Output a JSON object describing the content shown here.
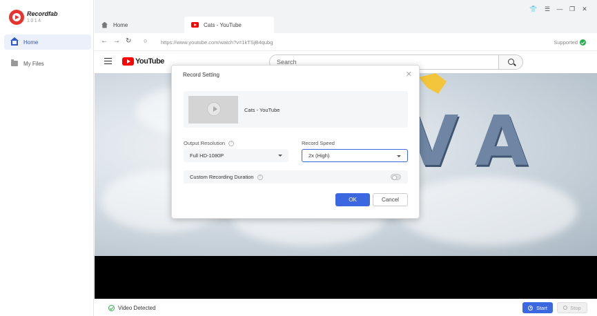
{
  "app": {
    "name": "Recordfab",
    "version": "1014"
  },
  "sidebar": {
    "items": [
      {
        "label": "Home",
        "active": true
      },
      {
        "label": "My Files",
        "active": false
      }
    ]
  },
  "tabs": [
    {
      "label": "Home",
      "icon": "home-icon"
    },
    {
      "label": "Cats - YouTube",
      "icon": "youtube-icon",
      "active": true
    }
  ],
  "window_controls": [
    "shirt-icon",
    "menu-icon",
    "minimize-icon",
    "restore-icon",
    "close-icon"
  ],
  "addressbar": {
    "url": "https://www.youtube.com/watch?v=1kTSjB4qubg",
    "supported": "Supported"
  },
  "youtube": {
    "logo_text": "YouTube",
    "search_placeholder": "Search"
  },
  "video": {
    "overlay_text": "VA"
  },
  "status": {
    "detected": "Video Detected",
    "start": "Start",
    "stop": "Stop"
  },
  "modal": {
    "title": "Record Setting",
    "video_title": "Cats - YouTube",
    "resolution_label": "Output Resolution",
    "resolution_value": "Full HD-1080P",
    "speed_label": "Record Speed",
    "speed_value": "2x (High)",
    "custom_duration_label": "Custom Recording Duration",
    "custom_duration_enabled": false,
    "ok": "OK",
    "cancel": "Cancel"
  },
  "colors": {
    "accent": "#3b68e0",
    "brand": "#e8342f",
    "youtube_red": "#ff0000",
    "success": "#22b14c"
  }
}
